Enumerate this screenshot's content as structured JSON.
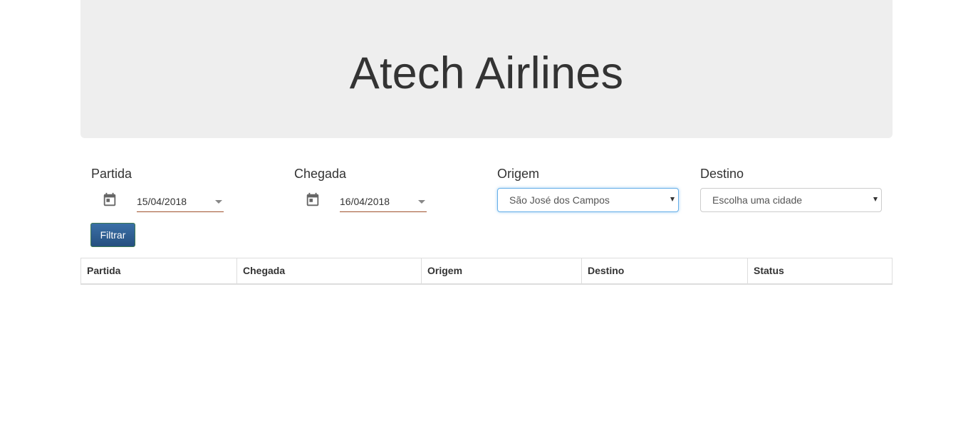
{
  "header": {
    "title": "Atech Airlines"
  },
  "filters": {
    "departure": {
      "label": "Partida",
      "value": "15/04/2018"
    },
    "arrival": {
      "label": "Chegada",
      "value": "16/04/2018"
    },
    "origin": {
      "label": "Origem",
      "selected": "São José dos Campos"
    },
    "destination": {
      "label": "Destino",
      "selected": "Escolha uma cidade"
    },
    "filter_button": "Filtrar"
  },
  "table": {
    "columns": [
      "Partida",
      "Chegada",
      "Origem",
      "Destino",
      "Status"
    ],
    "rows": []
  },
  "colors": {
    "jumbotron_bg": "#eeeeee",
    "button_bg": "#2b5a8a",
    "date_underline": "#a0522d",
    "focus_border": "#66afe9"
  },
  "icons": {
    "departure_icon": "calendar-icon",
    "arrival_icon": "calendar-icon"
  }
}
